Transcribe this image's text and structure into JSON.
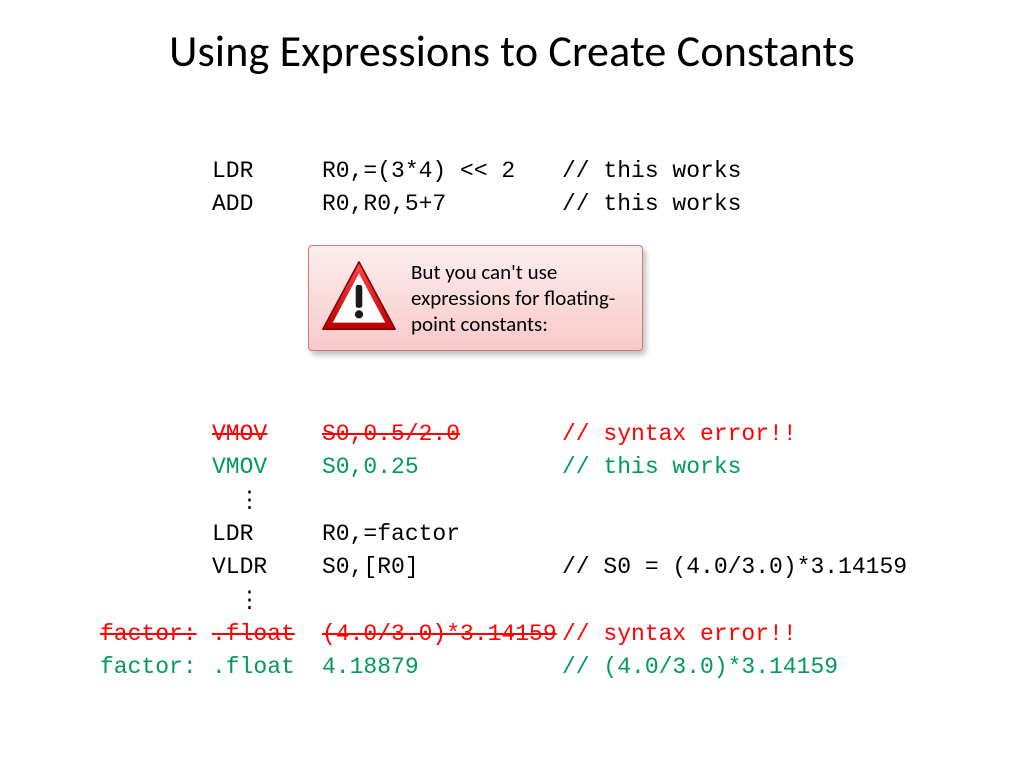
{
  "title": "Using Expressions to Create Constants",
  "callout": {
    "message": "But you can't use expressions for floating-point constants:"
  },
  "code_top": [
    {
      "label": "",
      "op": "LDR",
      "arg": "R0,=(3*4) << 2",
      "cmt": "// this works",
      "style": "plain"
    },
    {
      "label": "",
      "op": "ADD",
      "arg": "R0,R0,5+7",
      "cmt": "// this works",
      "style": "plain"
    }
  ],
  "code_bottom": [
    {
      "label": "",
      "op": "VMOV",
      "arg": "S0,0.5/2.0",
      "cmt": "// syntax error!!",
      "style": "red-strike"
    },
    {
      "label": "",
      "op": "VMOV",
      "arg": "S0,0.25",
      "cmt": "// this works",
      "style": "green"
    },
    {
      "ellipsis": "⋮"
    },
    {
      "label": "",
      "op": "LDR",
      "arg": "R0,=factor",
      "cmt": "",
      "style": "plain"
    },
    {
      "label": "",
      "op": "VLDR",
      "arg": "S0,[R0]",
      "cmt": "// S0 = (4.0/3.0)*3.14159",
      "style": "plain"
    },
    {
      "ellipsis": "⋮"
    },
    {
      "label": "factor:",
      "op": ".float",
      "arg": "(4.0/3.0)*3.14159",
      "cmt": "// syntax error!!",
      "style": "red-strike"
    },
    {
      "label": "factor:",
      "op": ".float",
      "arg": "4.18879",
      "cmt": "// (4.0/3.0)*3.14159",
      "style": "green"
    }
  ]
}
